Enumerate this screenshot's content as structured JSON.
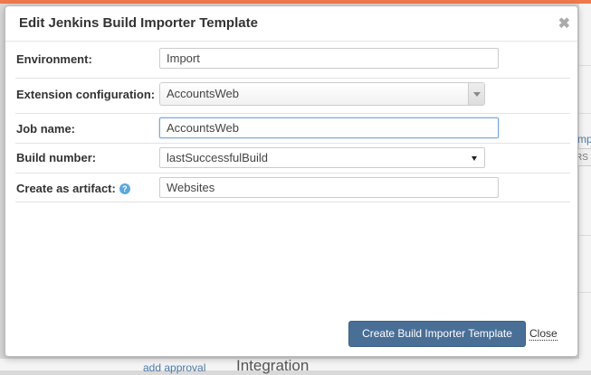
{
  "background": {
    "peek_text": "mp",
    "peek_badge": "RS",
    "link": "add approval",
    "heading": "Integration"
  },
  "modal": {
    "title": "Edit Jenkins Build Importer Template",
    "close_icon": "close-icon"
  },
  "form": {
    "environment": {
      "label": "Environment:",
      "value": "Import"
    },
    "extension_configuration": {
      "label": "Extension configuration:",
      "value": "AccountsWeb"
    },
    "job_name": {
      "label": "Job name:",
      "value": "AccountsWeb"
    },
    "build_number": {
      "label": "Build number:",
      "value": "lastSuccessfulBuild"
    },
    "create_as_artifact": {
      "label": "Create as artifact:",
      "value": "Websites",
      "help_icon": "help-icon"
    }
  },
  "footer": {
    "submit_label": "Create Build Importer Template",
    "close_label": "Close"
  },
  "colors": {
    "accent_top_bar": "#f0784c",
    "primary_button": "#4a6f97",
    "help_icon": "#5aa8e0"
  }
}
